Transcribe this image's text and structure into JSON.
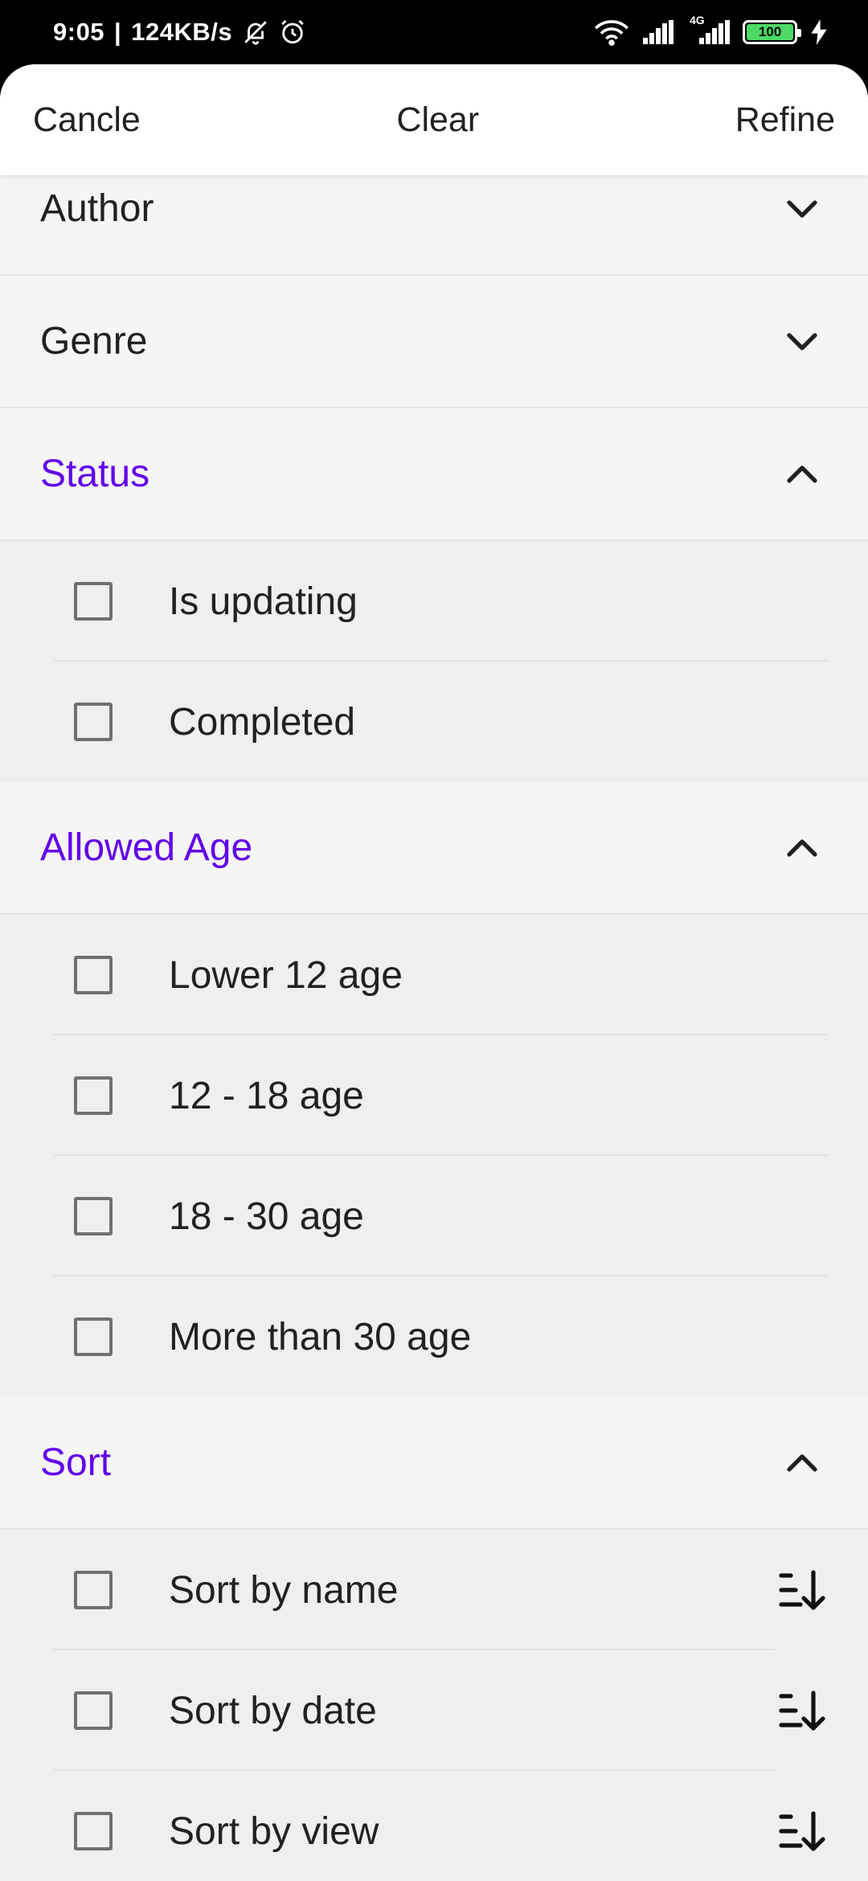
{
  "status_bar": {
    "time": "9:05",
    "speed": "124KB/s",
    "network_label": "4G",
    "battery_level": "100"
  },
  "header": {
    "cancel_label": "Cancle",
    "clear_label": "Clear",
    "refine_label": "Refine"
  },
  "sections": {
    "author": {
      "title": "Author",
      "expanded": false
    },
    "genre": {
      "title": "Genre",
      "expanded": false
    },
    "status": {
      "title": "Status",
      "expanded": true,
      "options": [
        "Is updating",
        "Completed"
      ]
    },
    "allowed_age": {
      "title": "Allowed Age",
      "expanded": true,
      "options": [
        "Lower 12 age",
        "12 - 18 age",
        "18 - 30 age",
        "More than 30 age"
      ]
    },
    "sort": {
      "title": "Sort",
      "expanded": true,
      "options": [
        "Sort by name",
        "Sort by date",
        "Sort by view"
      ]
    }
  },
  "colors": {
    "accent": "#6200ea",
    "text": "#212121",
    "battery": "#4cd964"
  },
  "icons": {
    "collapsed": "chevron-down-icon",
    "expanded": "chevron-up-icon",
    "sort": "sort-descending-icon"
  }
}
